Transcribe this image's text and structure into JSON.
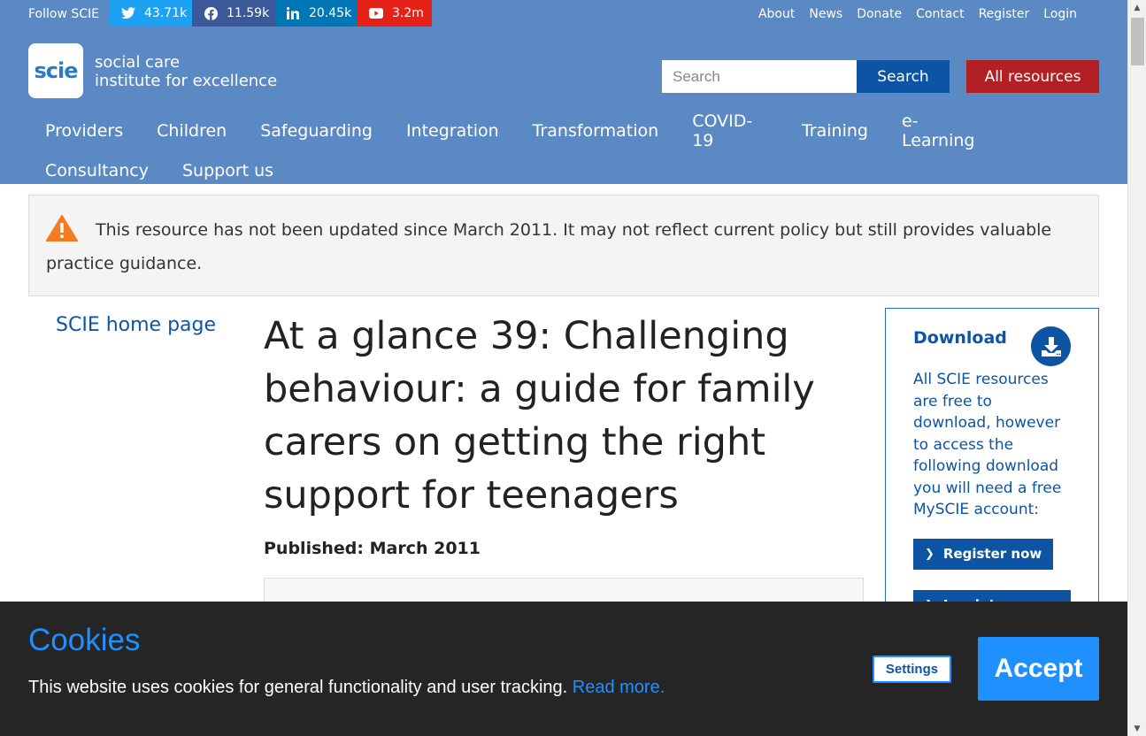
{
  "topbar": {
    "follow": "Follow SCIE",
    "social": {
      "twitter": "43.71k",
      "facebook": "11.59k",
      "linkedin": "20.45k",
      "youtube": "3.2m"
    },
    "links": [
      "About",
      "News",
      "Donate",
      "Contact",
      "Register",
      "Login"
    ]
  },
  "header": {
    "logo": "scie",
    "logo_line1": "social care",
    "logo_line2": "institute for excellence",
    "search_placeholder": "Search",
    "search_button": "Search",
    "all_resources": "All resources",
    "nav_row1": [
      "Providers",
      "Children",
      "Safeguarding",
      "Integration",
      "Transformation",
      "COVID-19",
      "Training",
      "e-Learning"
    ],
    "nav_row2": [
      "Consultancy",
      "Support us"
    ]
  },
  "notice": {
    "text": "This resource has not been updated since March 2011. It may not reflect current policy but still provides valuable practice guidance."
  },
  "leftnav": {
    "home": "SCIE home page"
  },
  "main": {
    "title": "At a glance 39: Challenging behaviour: a guide for family carers on getting the right support for teenagers",
    "published": "Published: March 2011"
  },
  "download": {
    "title": "Download",
    "text": "All SCIE resources are free to download, however to access the following download you will need a free MySCIE account:",
    "register": "Register now",
    "login": "Log into your"
  },
  "cookie": {
    "title": "Cookies",
    "text": "This website uses cookies for general functionality and user tracking.",
    "read_more": "Read more.",
    "settings": "Settings",
    "accept": "Accept"
  },
  "colors": {
    "header_blue": "#5a89c4",
    "dark_blue": "#0d55a4",
    "red": "#b32024",
    "cookie_bg": "#252526",
    "cookie_accent": "#1e90ff"
  }
}
